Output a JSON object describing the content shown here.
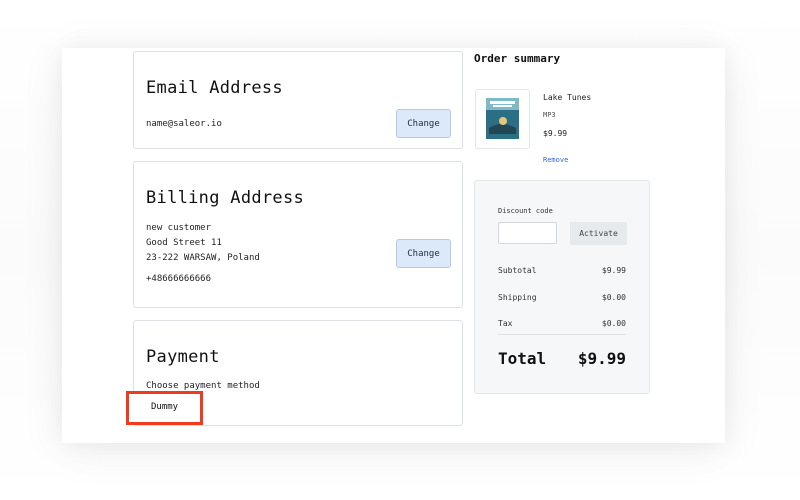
{
  "email": {
    "title": "Email Address",
    "value": "name@saleor.io",
    "change_label": "Change"
  },
  "billing": {
    "title": "Billing Address",
    "name": "new customer",
    "street": "Good Street 11",
    "city": "23-222 WARSAW, Poland",
    "phone": "+48666666666",
    "change_label": "Change"
  },
  "payment": {
    "title": "Payment",
    "choose_label": "Choose payment method",
    "method": "Dummy"
  },
  "summary": {
    "title": "Order summary",
    "item": {
      "name": "Lake Tunes",
      "variant": "MP3",
      "price": "$9.99",
      "remove_label": "Remove",
      "thumb_icon": "album-cover-image"
    },
    "discount_label": "Discount code",
    "discount_placeholder": "",
    "activate_label": "Activate",
    "subtotal_label": "Subtotal",
    "subtotal_value": "$9.99",
    "shipping_label": "Shipping",
    "shipping_value": "$0.00",
    "tax_label": "Tax",
    "tax_value": "$0.00",
    "total_label": "Total",
    "total_value": "$9.99"
  },
  "colors": {
    "accent_link": "#2f6bd8",
    "button_bg": "#dce9fb",
    "highlight": "#f23a1f"
  }
}
